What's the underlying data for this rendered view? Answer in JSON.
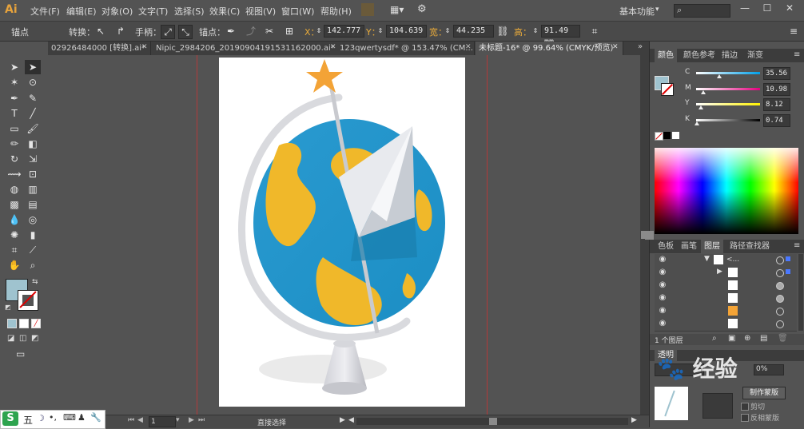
{
  "app": {
    "logo": "Ai"
  },
  "menu": [
    "文件(F)",
    "编辑(E)",
    "对象(O)",
    "文字(T)",
    "选择(S)",
    "效果(C)",
    "视图(V)",
    "窗口(W)",
    "帮助(H)"
  ],
  "workspace": "基本功能",
  "window_buttons": [
    "—",
    "☐",
    "✕"
  ],
  "control": {
    "mode_label": "锚点",
    "convert_label": "转换：",
    "handles_label": "手柄：",
    "anchor_label": "锚点：",
    "x_label": "X：",
    "x_value": "142.777",
    "y_label": "Y：",
    "y_value": "104.639",
    "w_label": "宽：",
    "w_value": "44.235",
    "h_label": "高：",
    "h_value": "91.49 mm"
  },
  "tabs": [
    {
      "label": "02926484000 [转换].ai*",
      "active": false
    },
    {
      "label": "Nipic_2984206_20190904191531162000.ai*",
      "active": false
    },
    {
      "label": "123qwertysdf* @ 153.47% (CM...",
      "active": false
    },
    {
      "label": "未标题-16* @ 99.64% (CMYK/预览)",
      "active": true
    }
  ],
  "status": {
    "zoom": "1",
    "tool": "直接选择"
  },
  "color_panel": {
    "tabs": [
      "颜色",
      "颜色参考",
      "描边",
      "渐变"
    ],
    "active_tab": "颜色",
    "fill_color": "#9fc3cf",
    "channels": [
      {
        "label": "C",
        "value": "35.56",
        "pct": 0.36,
        "gradient": [
          "#ffffff",
          "#00a0e9"
        ]
      },
      {
        "label": "M",
        "value": "10.98",
        "pct": 0.11,
        "gradient": [
          "#ffffff",
          "#e4007f"
        ]
      },
      {
        "label": "Y",
        "value": "8.12",
        "pct": 0.08,
        "gradient": [
          "#ffffff",
          "#fff100"
        ]
      },
      {
        "label": "K",
        "value": "0.74",
        "pct": 0.01,
        "gradient": [
          "#ffffff",
          "#000000"
        ]
      }
    ]
  },
  "layers_panel": {
    "tabs": [
      "色板",
      "画笔",
      "图层",
      "路径查找器"
    ],
    "active_tab": "图层",
    "rows": [
      {
        "label": "<...",
        "expanded": true
      },
      {
        "label": "",
        "expanded": false
      },
      {
        "label": ""
      },
      {
        "label": ""
      },
      {
        "label": ""
      },
      {
        "label": ""
      }
    ],
    "footer": "1 个图层"
  },
  "transparency": {
    "label": "透明",
    "opacity": "0%",
    "button": "制作蒙版",
    "clip_label": "剪切",
    "invert_label": "反相蒙版"
  },
  "taskbar": {
    "ime": "五"
  }
}
